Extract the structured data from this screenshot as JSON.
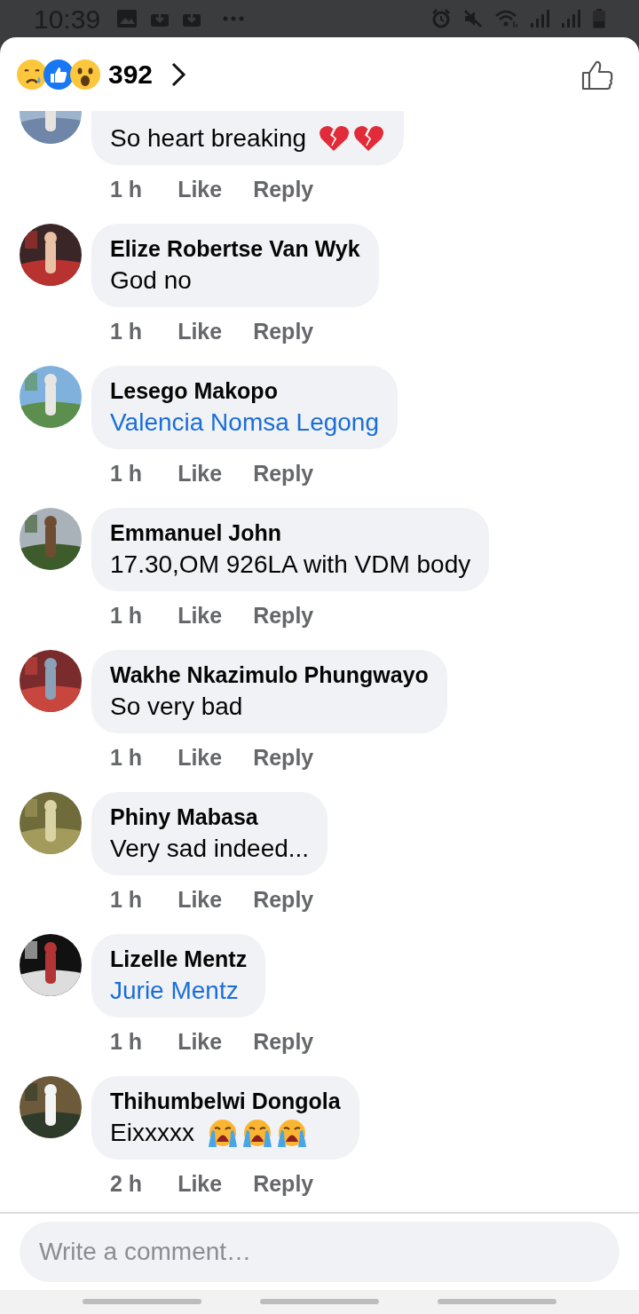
{
  "status_bar": {
    "time": "10:39"
  },
  "header": {
    "reaction_count": "392"
  },
  "comments": [
    {
      "body": "So heart breaking",
      "kind": "text",
      "emojis": [
        {
          "kind": "broken-heart"
        },
        {
          "kind": "broken-heart"
        }
      ],
      "time": "1 h",
      "like": "Like",
      "reply": "Reply"
    },
    {
      "name": "Elize Robertse Van Wyk",
      "body": "God no",
      "kind": "text",
      "time": "1 h",
      "like": "Like",
      "reply": "Reply"
    },
    {
      "name": "Lesego Makopo",
      "body": "Valencia Nomsa Legong",
      "kind": "mention",
      "time": "1 h",
      "like": "Like",
      "reply": "Reply"
    },
    {
      "name": "Emmanuel John",
      "body": "17.30,OM 926LA with VDM body",
      "kind": "text",
      "time": "1 h",
      "like": "Like",
      "reply": "Reply"
    },
    {
      "name": "Wakhe Nkazimulo Phungwayo",
      "body": "So very bad",
      "kind": "text",
      "time": "1 h",
      "like": "Like",
      "reply": "Reply"
    },
    {
      "name": "Phiny Mabasa",
      "body": "Very sad indeed...",
      "kind": "text",
      "time": "1 h",
      "like": "Like",
      "reply": "Reply"
    },
    {
      "name": "Lizelle Mentz",
      "body": "Jurie Mentz",
      "kind": "mention",
      "time": "1 h",
      "like": "Like",
      "reply": "Reply"
    },
    {
      "name": "Thihumbelwi Dongola",
      "body": "Eixxxxx",
      "kind": "text",
      "emojis": [
        {
          "kind": "crying-face"
        },
        {
          "kind": "crying-face"
        },
        {
          "kind": "crying-face"
        }
      ],
      "time": "2 h",
      "like": "Like",
      "reply": "Reply"
    }
  ],
  "composer": {
    "placeholder": "Write a comment…"
  }
}
